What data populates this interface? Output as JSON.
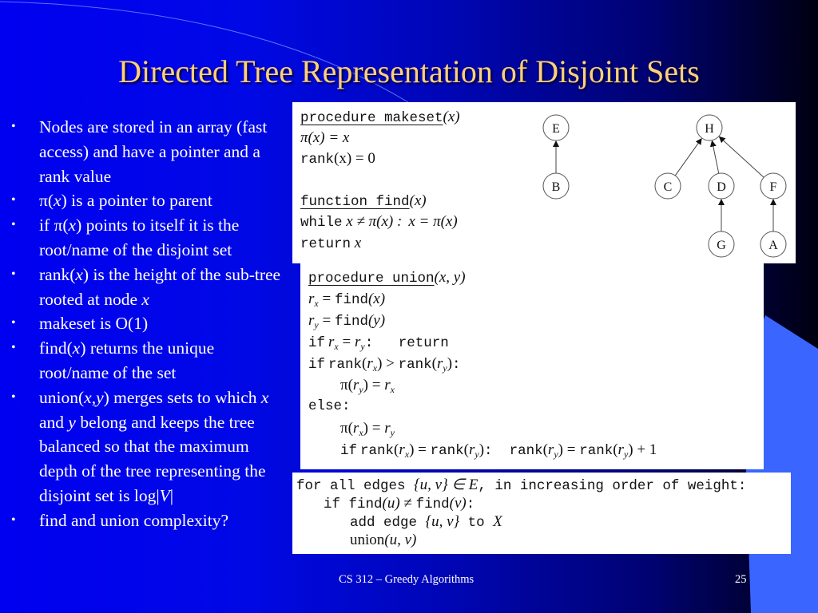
{
  "slide": {
    "title": "Directed Tree Representation of Disjoint Sets",
    "colors": {
      "background_left": "#0000f0",
      "background_right": "#000010",
      "title": "#ffd07a",
      "accent_panel": "#3a66ff",
      "text": "#ffffff"
    },
    "bullets": [
      {
        "parts": [
          "Nodes are stored in an array (fast access) and have a pointer and a rank value"
        ]
      },
      {
        "pre": "π(",
        "var": "x",
        "post": ") is a pointer to parent"
      },
      {
        "pre": "if π(",
        "var": "x",
        "post": ") points to itself it is the root/name of the disjoint set"
      },
      {
        "pre": "rank(",
        "var": "x",
        "mid": ") is the height of the sub-tree rooted at node ",
        "var2": "x"
      },
      {
        "text": "makeset is O(1)"
      },
      {
        "pre": "find(",
        "var": "x",
        "post": ") returns the unique root/name of the set"
      },
      {
        "pre": "union(",
        "var": "x",
        "comma": ",",
        "var2": "y",
        "mid": ") merges sets to which ",
        "var3": "x",
        "mid2": " and ",
        "var4": "y",
        "post": " belong and keeps the tree balanced so that the maximum depth of the tree representing the disjoint set is log|",
        "var5": "V",
        "end": "|"
      },
      {
        "text": "find and union complexity?"
      }
    ],
    "bullet_symbol": "•",
    "makeset_find_code": {
      "makeset_kw": "procedure makeset",
      "makeset_args": "(x)",
      "line1_lhs": "π(x) = x",
      "line2_kw": "rank",
      "line2_rest": "(x) = 0",
      "find_kw": "function find",
      "find_args": "(x)",
      "while_kw": "while",
      "while_cond": " x ≠ π(x) :",
      "while_body": "x = π(x)",
      "return_kw": "return",
      "return_val": " x"
    },
    "union_code": {
      "header_kw": "procedure union",
      "header_args": "(x, y)",
      "l1_var": "r",
      "l1_sub": "x",
      "l1_eq": " = ",
      "l1_fn": "find",
      "l1_arg": "(x)",
      "l2_var": "r",
      "l2_sub": "y",
      "l2_eq": " = ",
      "l2_fn": "find",
      "l2_arg": "(y)",
      "if_kw": "if",
      "return_kw": "return",
      "rank_kw": "rank",
      "else_kw": "else:",
      "plus_one": "+ 1"
    },
    "kruskal_code": {
      "line1_a": "for all edges ",
      "line1_set": "{u, v} ∈ E",
      "line1_b": ", in increasing order of weight:",
      "line2_a": "if ",
      "line2_find1": "find",
      "line2_arg1": "(u)",
      "line2_neq": " ≠ ",
      "line2_find2": "find",
      "line2_arg2": "(v)",
      "line2_colon": ":",
      "line3_a": "add edge ",
      "line3_set": "{u, v}",
      "line3_b": " to ",
      "line3_X": "X",
      "line4_fn": "union",
      "line4_args": "(u, v)"
    },
    "tree_diagram": {
      "nodes": [
        "E",
        "B",
        "H",
        "C",
        "D",
        "F",
        "G",
        "A"
      ],
      "edges": [
        [
          "B",
          "E"
        ],
        [
          "C",
          "H"
        ],
        [
          "D",
          "H"
        ],
        [
          "F",
          "H"
        ],
        [
          "G",
          "D"
        ],
        [
          "A",
          "F"
        ]
      ]
    },
    "footer": {
      "course": "CS 312 – Greedy Algorithms",
      "page_number": "25"
    }
  }
}
